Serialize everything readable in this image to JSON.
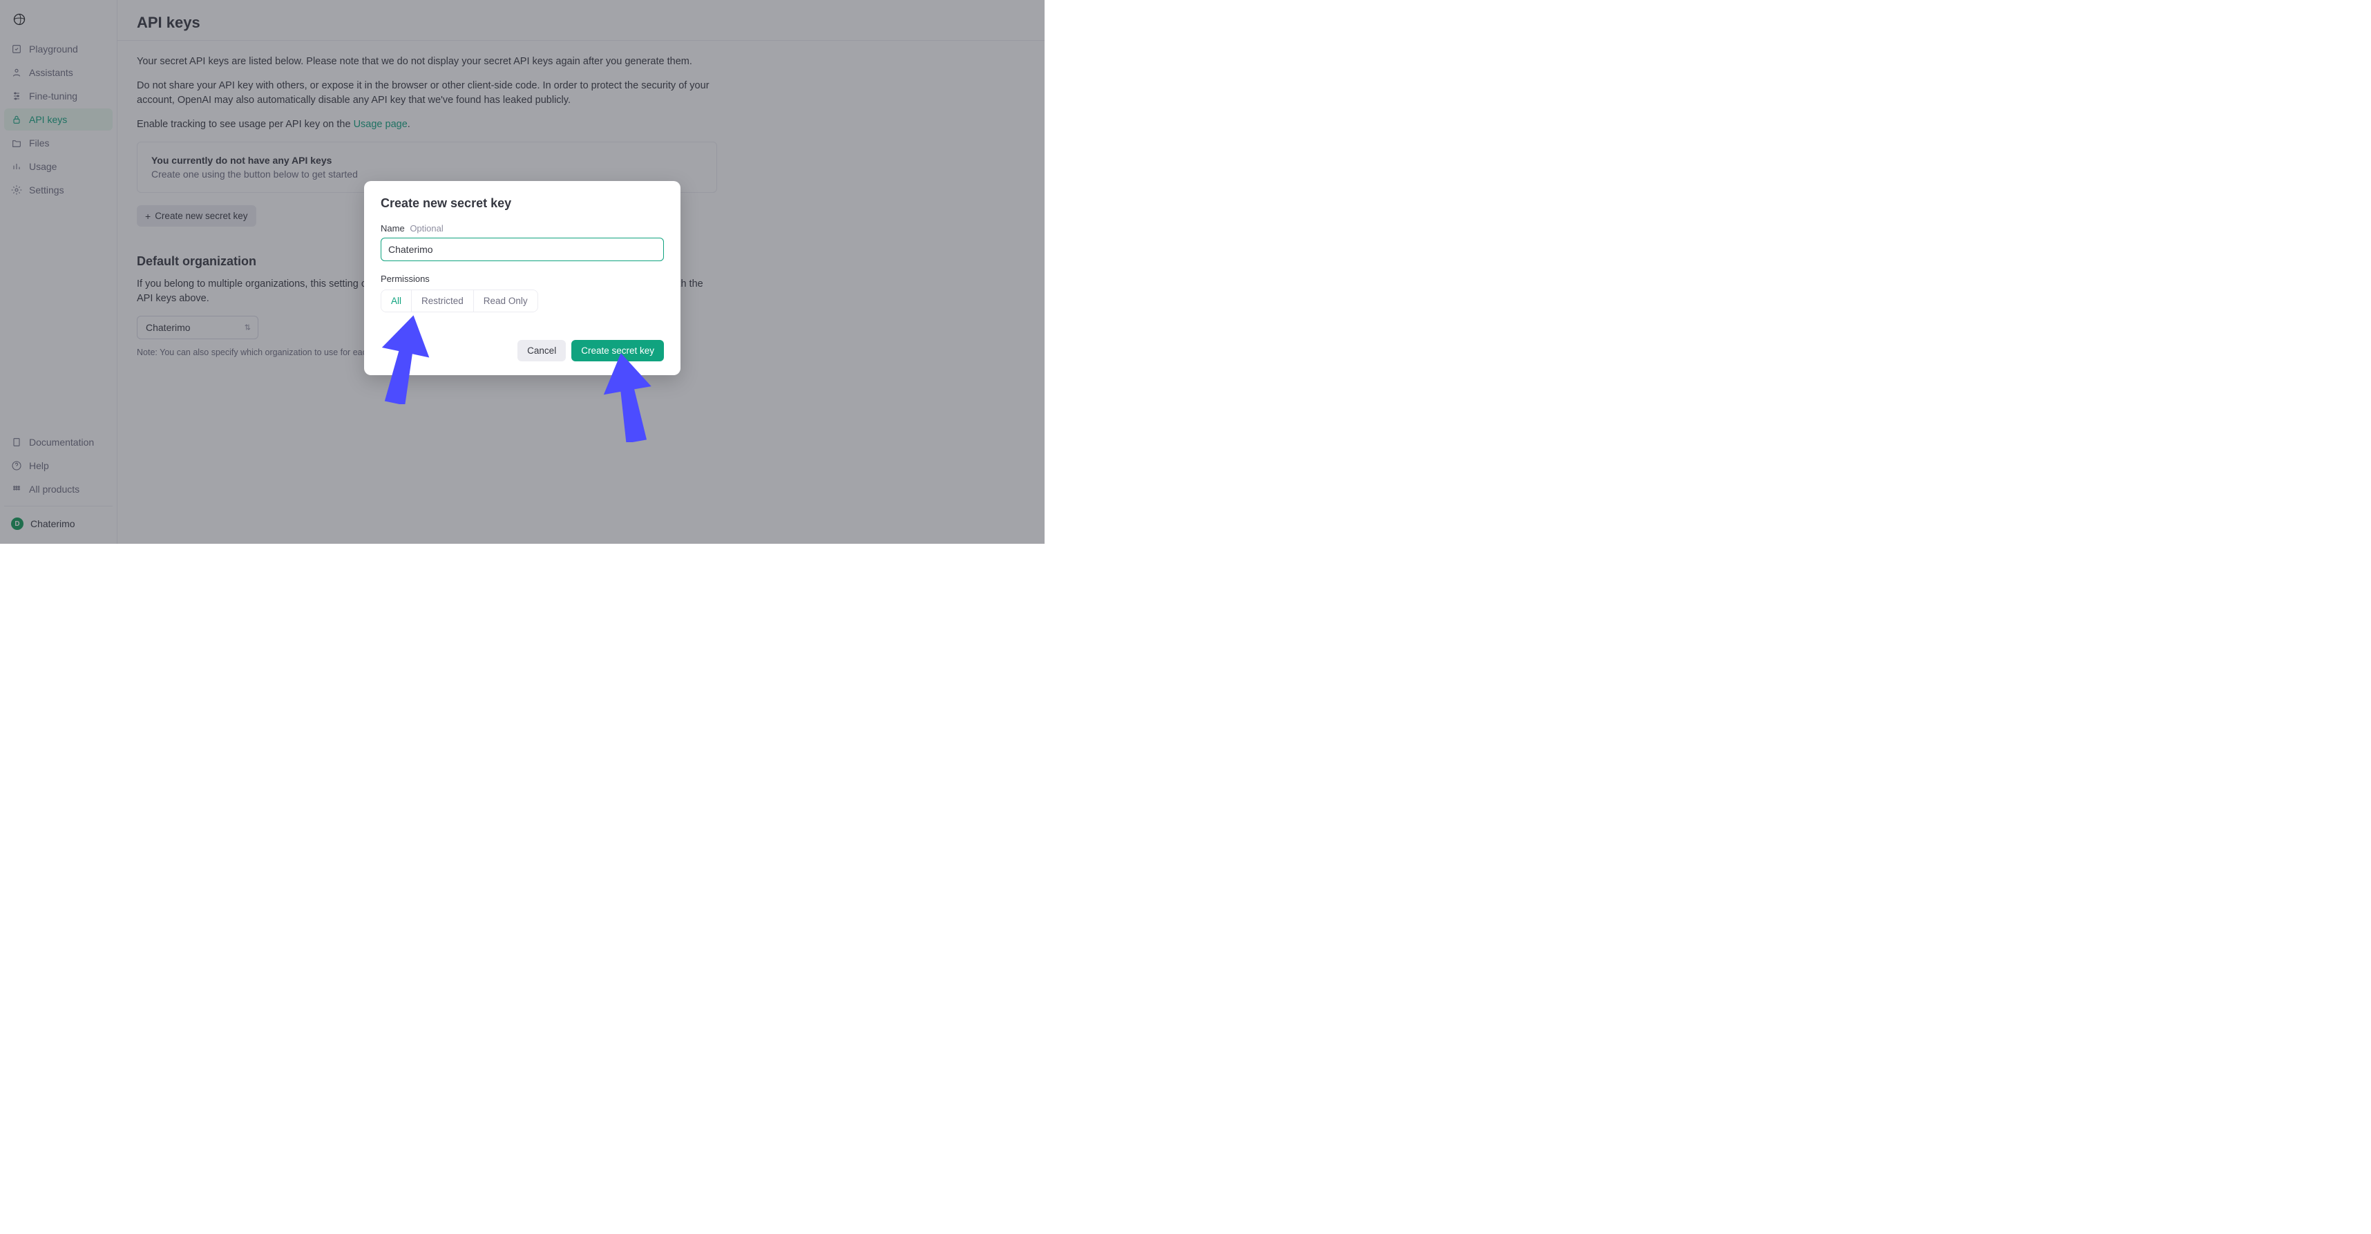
{
  "sidebar": {
    "items": [
      {
        "label": "Playground",
        "icon": "playground-icon"
      },
      {
        "label": "Assistants",
        "icon": "assistants-icon"
      },
      {
        "label": "Fine-tuning",
        "icon": "finetune-icon"
      },
      {
        "label": "API keys",
        "icon": "lock-icon"
      },
      {
        "label": "Files",
        "icon": "folder-icon"
      },
      {
        "label": "Usage",
        "icon": "chart-icon"
      },
      {
        "label": "Settings",
        "icon": "gear-icon"
      }
    ],
    "bottom": [
      {
        "label": "Documentation",
        "icon": "doc-icon"
      },
      {
        "label": "Help",
        "icon": "help-icon"
      },
      {
        "label": "All products",
        "icon": "grid-icon"
      }
    ],
    "user_letter": "D",
    "user_label": "Chaterimo"
  },
  "page": {
    "title": "API keys",
    "intro1": "Your secret API keys are listed below. Please note that we do not display your secret API keys again after you generate them.",
    "intro2": "Do not share your API key with others, or expose it in the browser or other client-side code. In order to protect the security of your account, OpenAI may also automatically disable any API key that we've found has leaked publicly.",
    "tracking_prefix": "Enable tracking to see usage per API key on the ",
    "tracking_link": "Usage page",
    "tracking_suffix": ".",
    "empty_title": "You currently do not have any API keys",
    "empty_sub": "Create one using the button below to get started",
    "create_btn": "Create new secret key",
    "section_title": "Default organization",
    "org_text": "If you belong to multiple organizations, this setting controls which organization is used by default when making requests with the API keys above.",
    "org_selected": "Chaterimo",
    "note": "Note: You can also specify which organization to use for each API request. See Authentication to learn more."
  },
  "modal": {
    "title": "Create new secret key",
    "name_label": "Name",
    "name_optional": "Optional",
    "name_value": "Chaterimo",
    "perm_label": "Permissions",
    "perm_options": [
      "All",
      "Restricted",
      "Read Only"
    ],
    "cancel": "Cancel",
    "create": "Create secret key"
  }
}
